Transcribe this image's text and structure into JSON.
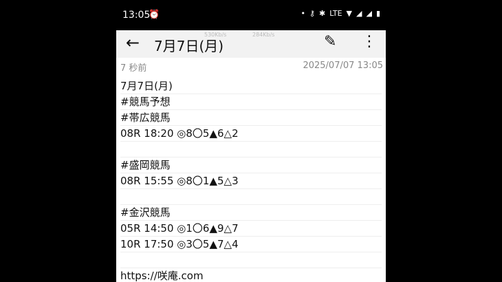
{
  "status": {
    "time": "13:05",
    "alarm_icon": "⏰",
    "dot": "•",
    "key_icon": "⚷",
    "bt_icon": "✱",
    "lte": "LTE",
    "wifi_icon": "▼",
    "signal1": "◢",
    "signal2": "◢",
    "battery": "▮"
  },
  "appbar": {
    "title": "7月7日(月)",
    "speed1": "530Kb/s",
    "speed2": "284Kb/s"
  },
  "note": {
    "elapsed": "7 秒前",
    "timestamp": "2025/07/07 13:05",
    "lines": [
      "7月7日(月)",
      "#競馬予想",
      "#帯広競馬",
      "08R 18:20 ◎8〇5▲6△2",
      "",
      "#盛岡競馬",
      "08R 15:55 ◎8〇1▲5△3",
      "",
      "#金沢競馬",
      "05R 14:50 ◎1〇6▲9△7",
      "10R 17:50 ◎3〇5▲7△4",
      "",
      "https://咲庵.com"
    ]
  }
}
